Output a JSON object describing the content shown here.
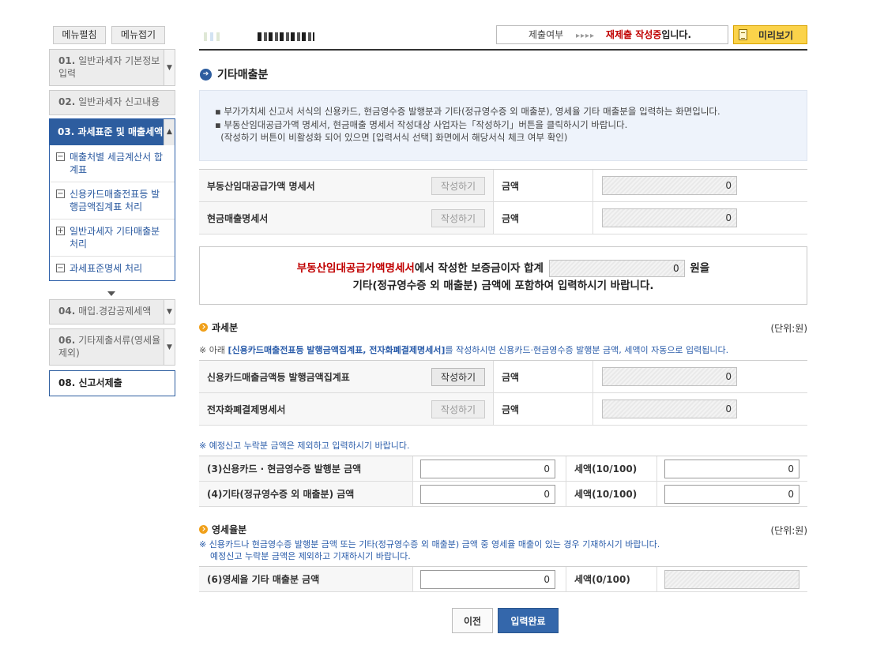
{
  "sidebar": {
    "top_buttons": [
      "메뉴펼침",
      "메뉴접기"
    ],
    "item1": {
      "num": "01.",
      "label": "일반과세자 기본정보 입력"
    },
    "item2": {
      "num": "02.",
      "label": "일반과세자 신고내용"
    },
    "active": {
      "label": "03. 과세표준 및 매출세액",
      "subs": [
        {
          "mark": "−",
          "label": "매출처별 세금계산서 합계표"
        },
        {
          "mark": "−",
          "label": "신용카드매출전표등 발행금액집계표 처리"
        },
        {
          "mark": "+",
          "label": "일반과세자 기타매출분 처리"
        },
        {
          "mark": "−",
          "label": "과세표준명세 처리"
        }
      ]
    },
    "item4": {
      "num": "04.",
      "label": "매입.경감공제세액"
    },
    "item6": {
      "num": "06.",
      "label": "기타제출서류(영세율 제외)"
    },
    "item8": {
      "num": "08.",
      "label": "신고서제출"
    }
  },
  "header": {
    "status_label": "제출여부",
    "status_arrows": "▸▸▸▸",
    "status_red": "재제출 작성중",
    "status_tail": "입니다.",
    "preview_label": "미리보기"
  },
  "main": {
    "title": "기타매출분",
    "notice": [
      "▪ 부가가치세 신고서 서식의 신용카드, 현금영수증 발행분과 기타(정규영수증 외 매출분), 영세율 기타 매출분을 입력하는 화면입니다.",
      "▪ 부동산임대공급가액 명세서, 현금매출 명세서 작성대상 사업자는「작성하기」버튼을 클릭하시기 바랍니다.",
      "  (작성하기 버튼이 비활성화 되어 있으면 [입력서식 선택] 화면에서 해당서식 체크 여부 확인)"
    ],
    "top_rows": [
      {
        "label": "부동산임대공급가액 명세서",
        "btn": "작성하기",
        "amt_label": "금액",
        "amt": "0"
      },
      {
        "label": "현금매출명세서",
        "btn": "작성하기",
        "amt_label": "금액",
        "amt": "0"
      }
    ],
    "deposit": {
      "red": "부동산임대공급가액명세서",
      "text1": "에서 작성한 보증금이자 합계",
      "value": "0",
      "text2": "원을",
      "line2": "기타(정규영수증 외 매출분) 금액에 포함하여 입력하시기 바랍니다."
    },
    "taxable": {
      "title": "과세분",
      "unit": "(단위:원)",
      "note_pre": "※ 아래 ",
      "note_bold": "[신용카드매출전표등 발행금액집계표, 전자화폐결제명세서]",
      "note_post": "를 작성하시면 신용카드·현금영수증 발행분 금액, 세액이 자동으로 입력됩니다.",
      "rows": [
        {
          "label": "신용카드매출금액등 발행금액집계표",
          "btn": "작성하기",
          "amt_label": "금액",
          "amt": "0"
        },
        {
          "label": "전자화폐결제명세서",
          "btn": "작성하기",
          "amt_label": "금액",
          "amt": "0"
        }
      ],
      "note2": "※ 예정신고 누락분 금액은 제외하고 입력하시기 바랍니다.",
      "input_rows": [
        {
          "label": "(3)신용카드 · 현금영수증 발행분 금액",
          "value": "0",
          "tax_label": "세액(10/100)",
          "tax": "0"
        },
        {
          "label": "(4)기타(정규영수증 외 매출분) 금액",
          "value": "0",
          "tax_label": "세액(10/100)",
          "tax": "0"
        }
      ]
    },
    "zero": {
      "title": "영세율분",
      "unit": "(단위:원)",
      "note1": "※ 신용카드나 현금영수증 발행분 금액 또는 기타(정규영수증 외 매출분) 금액 중 영세율 매출이 있는 경우 기재하시기 바랍니다.",
      "note2": "예정신고 누락분 금액은 제외하고 기재하시기 바랍니다.",
      "row": {
        "label": "(6)영세율 기타 매출분 금액",
        "value": "0",
        "tax_label": "세액(0/100)",
        "tax": ""
      }
    },
    "buttons": {
      "prev": "이전",
      "done": "입력완료"
    }
  }
}
